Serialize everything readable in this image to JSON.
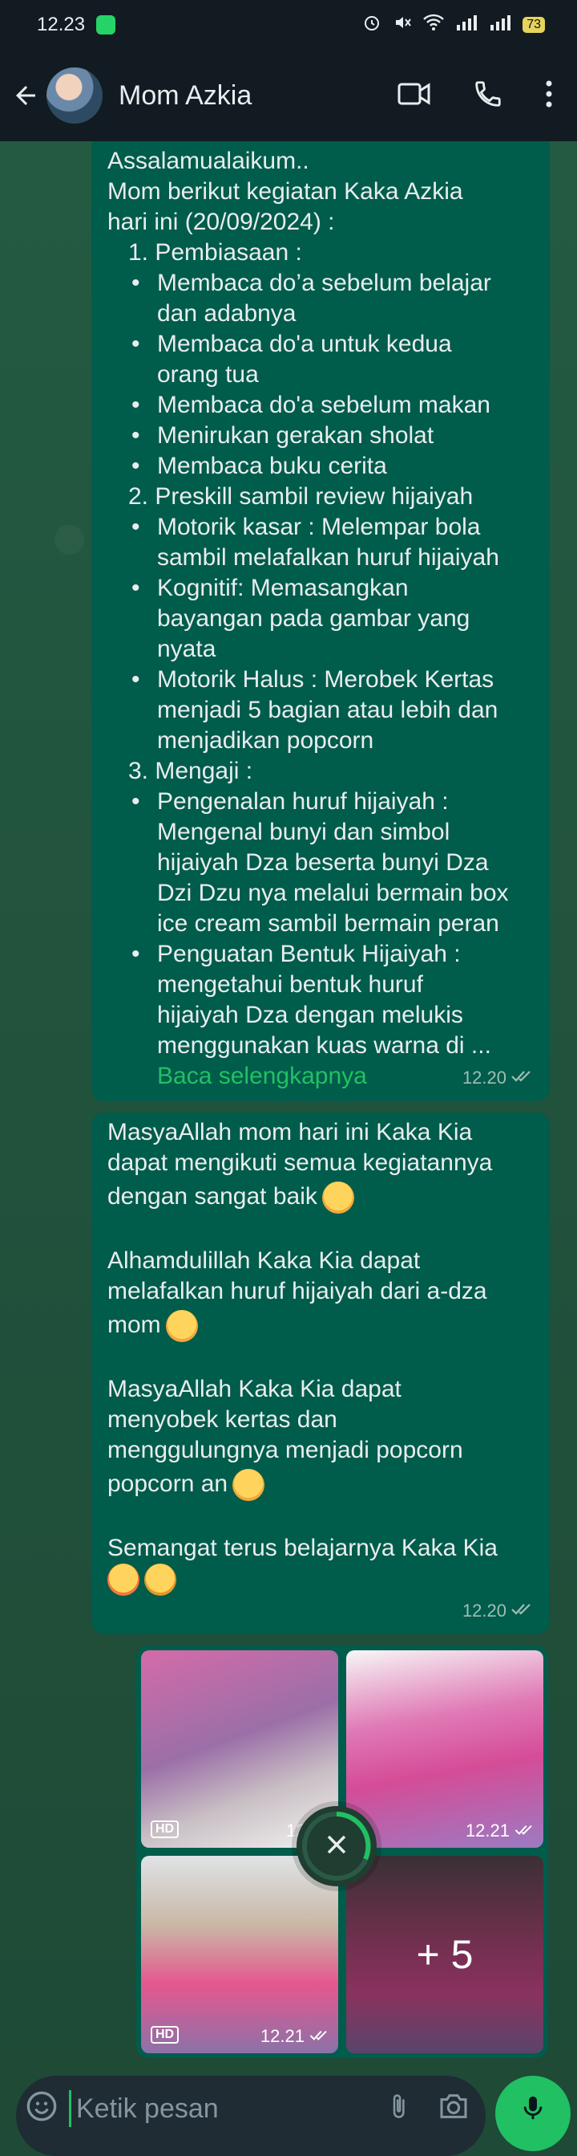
{
  "status_bar": {
    "time": "12.23",
    "battery": "73"
  },
  "header": {
    "contact_name": "Mom Azkia"
  },
  "messages": [
    {
      "lines": [
        "Assalamualaikum..",
        "Mom berikut kegiatan Kaka Azkia",
        "hari ini (20/09/2024) :"
      ],
      "items": [
        {
          "type": "num",
          "text": "1. Pembiasaan :"
        },
        {
          "type": "bullet",
          "text": "Membaca do’a sebelum belajar",
          "cont": [
            "dan adabnya"
          ]
        },
        {
          "type": "bullet",
          "text": "Membaca do'a untuk kedua",
          "cont": [
            "orang tua"
          ]
        },
        {
          "type": "bullet",
          "text": "Membaca do'a sebelum makan",
          "cont": []
        },
        {
          "type": "bullet",
          "text": "Menirukan gerakan sholat",
          "cont": []
        },
        {
          "type": "bullet",
          "text": "Membaca buku cerita",
          "cont": []
        },
        {
          "type": "num",
          "text": "2. Preskill sambil review hijaiyah"
        },
        {
          "type": "bullet",
          "text": "Motorik kasar :  Melempar bola",
          "cont": [
            "sambil melafalkan huruf hijaiyah"
          ]
        },
        {
          "type": "bullet",
          "text": "Kognitif:  Memasangkan",
          "cont": [
            "bayangan pada gambar yang",
            "nyata"
          ]
        },
        {
          "type": "bullet",
          "text": "Motorik Halus :  Merobek Kertas",
          "cont": [
            "menjadi 5 bagian atau lebih dan",
            "menjadikan popcorn"
          ]
        },
        {
          "type": "num",
          "text": "3. Mengaji :"
        },
        {
          "type": "bullet",
          "text": "Pengenalan huruf hijaiyah :",
          "cont": [
            "Mengenal bunyi dan simbol",
            "hijaiyah Dza beserta bunyi Dza",
            "Dzi Dzu nya melalui bermain box",
            "ice cream sambil bermain peran"
          ]
        },
        {
          "type": "bullet",
          "text": "Penguatan Bentuk Hijaiyah :",
          "cont": [
            "mengetahui bentuk huruf",
            "hijaiyah Dza   dengan melukis",
            "menggunakan kuas warna di ..."
          ]
        }
      ],
      "read_more": "Baca selengkapnya",
      "time": "12.20"
    },
    {
      "paragraphs": [
        [
          "MasyaAllah mom hari ini Kaka Kia",
          "dapat mengikuti semua kegiatannya",
          "dengan sangat baik"
        ],
        [
          "Alhamdulillah Kaka Kia dapat",
          "melafalkan huruf hijaiyah dari a-dza",
          "mom"
        ],
        [
          "MasyaAllah Kaka Kia dapat",
          "menyobek kertas dan",
          "menggulungnya menjadi popcorn",
          "popcorn an"
        ],
        [
          "Semangat terus belajarnya Kaka Kia"
        ]
      ],
      "time": "12.20"
    }
  ],
  "album": {
    "thumbs": [
      {
        "hd": "HD",
        "time": "12.21"
      },
      {
        "hd": "",
        "time": "12.21"
      },
      {
        "hd": "HD",
        "time": "12.21"
      },
      {
        "overlay": "+ 5"
      }
    ]
  },
  "input": {
    "placeholder": "Ketik pesan"
  },
  "colors": {
    "outgoing_bubble": "#005c4b",
    "accent": "#21c063",
    "header": "#111b21"
  }
}
